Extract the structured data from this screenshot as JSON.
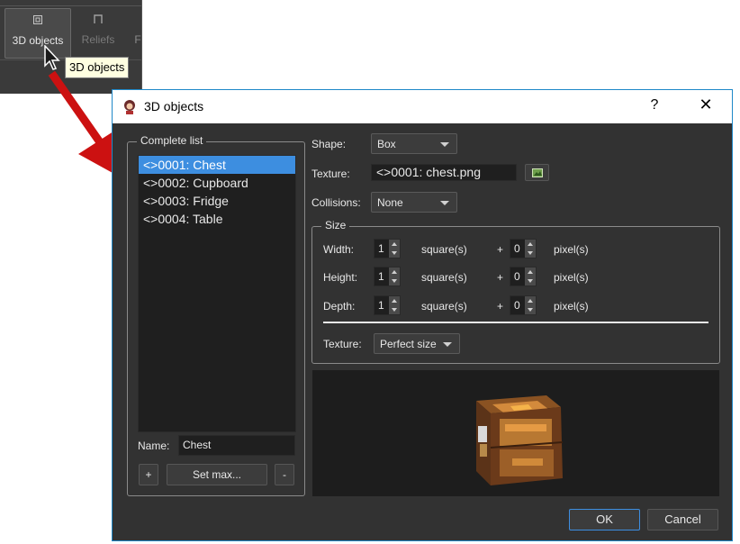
{
  "toolbar": {
    "active_label": "3D objects",
    "reliefs_label": "Reliefs",
    "cut_label": "F",
    "tooltip": "3D objects"
  },
  "dialog": {
    "title": "3D objects",
    "help": "?",
    "close": "✕",
    "complete_list": {
      "label": "Complete list",
      "items": [
        "<>0001: Chest",
        "<>0002: Cupboard",
        "<>0003: Fridge",
        "<>0004: Table"
      ],
      "selected_index": 0
    },
    "name": {
      "label": "Name:",
      "value": "Chest"
    },
    "buttons": {
      "add": "+",
      "set_max": "Set max...",
      "remove": "-"
    },
    "shape": {
      "label": "Shape:",
      "value": "Box"
    },
    "texture": {
      "label": "Texture:",
      "value": "<>0001: chest.png"
    },
    "collisions": {
      "label": "Collisions:",
      "value": "None"
    },
    "size": {
      "label": "Size",
      "rows": [
        {
          "label": "Width:",
          "squares": "1",
          "squares_unit": "square(s)",
          "plus": "+",
          "pixels": "0",
          "pixels_unit": "pixel(s)"
        },
        {
          "label": "Height:",
          "squares": "1",
          "squares_unit": "square(s)",
          "plus": "+",
          "pixels": "0",
          "pixels_unit": "pixel(s)"
        },
        {
          "label": "Depth:",
          "squares": "1",
          "squares_unit": "square(s)",
          "plus": "+",
          "pixels": "0",
          "pixels_unit": "pixel(s)"
        }
      ],
      "texture_label": "Texture:",
      "texture_mode": "Perfect size"
    },
    "ok": "OK",
    "cancel": "Cancel"
  },
  "colors": {
    "accent": "#3d8ee0",
    "arrow": "#cc1111",
    "dialog_bg": "#323232"
  }
}
